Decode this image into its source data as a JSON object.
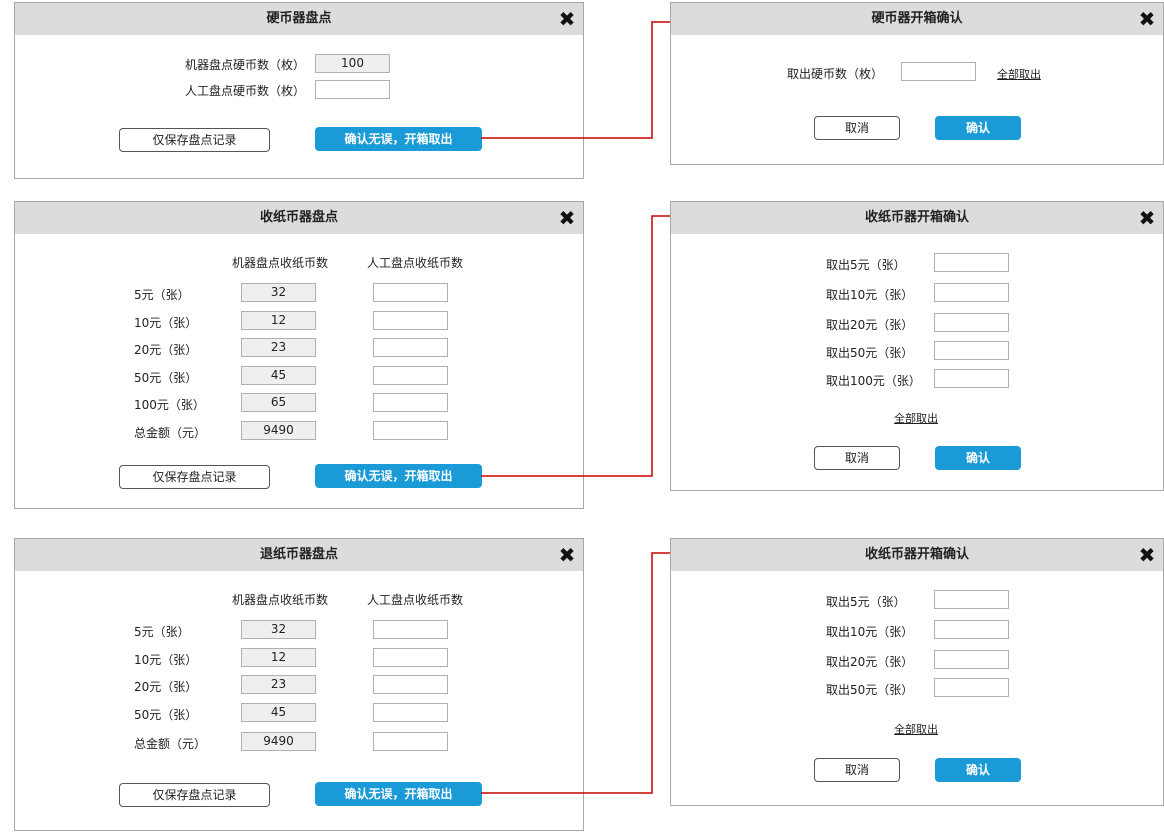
{
  "coin_count": {
    "title": "硬币器盘点",
    "machine_label": "机器盘点硬币数（枚）",
    "machine_value": "100",
    "manual_label": "人工盘点硬币数（枚）",
    "manual_value": "",
    "save_button": "仅保存盘点记录",
    "confirm_button": "确认无误，开箱取出"
  },
  "coin_confirm": {
    "title": "硬币器开箱确认",
    "take_label": "取出硬币数（枚）",
    "take_value": "",
    "take_all_link": "全部取出",
    "cancel_button": "取消",
    "ok_button": "确认"
  },
  "note_count": {
    "title": "收纸币器盘点",
    "col_machine": "机器盘点收纸币数",
    "col_manual": "人工盘点收纸币数",
    "rows": [
      {
        "label": "5元（张）",
        "machine": "32"
      },
      {
        "label": "10元（张）",
        "machine": "12"
      },
      {
        "label": "20元（张）",
        "machine": "23"
      },
      {
        "label": "50元（张）",
        "machine": "45"
      },
      {
        "label": "100元（张）",
        "machine": "65"
      },
      {
        "label": "总金额（元）",
        "machine": "9490"
      }
    ],
    "save_button": "仅保存盘点记录",
    "confirm_button": "确认无误，开箱取出"
  },
  "note_confirm": {
    "title": "收纸币器开箱确认",
    "rows": [
      "取出5元（张）",
      "取出10元（张）",
      "取出20元（张）",
      "取出50元（张）",
      "取出100元（张）"
    ],
    "take_all_link": "全部取出",
    "cancel_button": "取消",
    "ok_button": "确认"
  },
  "refund_count": {
    "title": "退纸币器盘点",
    "col_machine": "机器盘点收纸币数",
    "col_manual": "人工盘点收纸币数",
    "rows": [
      {
        "label": "5元（张）",
        "machine": "32"
      },
      {
        "label": "10元（张）",
        "machine": "12"
      },
      {
        "label": "20元（张）",
        "machine": "23"
      },
      {
        "label": "50元（张）",
        "machine": "45"
      },
      {
        "label": "总金额（元）",
        "machine": "9490"
      }
    ],
    "save_button": "仅保存盘点记录",
    "confirm_button": "确认无误，开箱取出"
  },
  "refund_confirm": {
    "title": "收纸币器开箱确认",
    "rows": [
      "取出5元（张）",
      "取出10元（张）",
      "取出20元（张）",
      "取出50元（张）"
    ],
    "take_all_link": "全部取出",
    "cancel_button": "取消",
    "ok_button": "确认"
  },
  "icons": {
    "close": "close-icon"
  },
  "colors": {
    "primary": "#1a9bd7",
    "connector": "#cc0000",
    "header_bg": "#dcdcdc"
  }
}
